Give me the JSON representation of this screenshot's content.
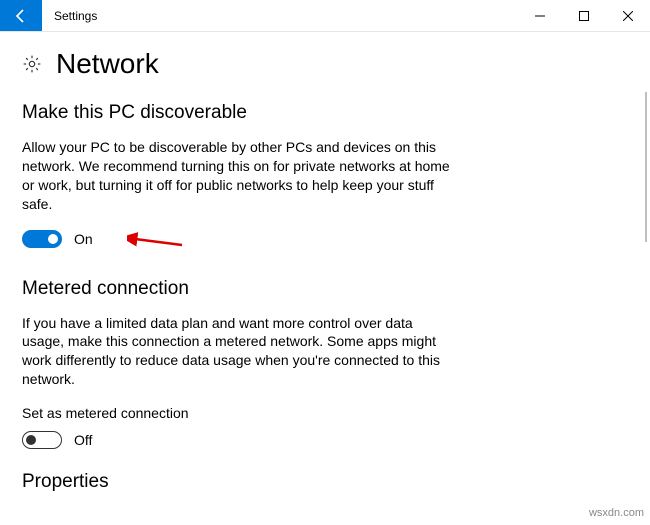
{
  "titlebar": {
    "back_icon": "back-arrow",
    "title": "Settings"
  },
  "page": {
    "heading": "Network"
  },
  "discoverable": {
    "heading": "Make this PC discoverable",
    "description": "Allow your PC to be discoverable by other PCs and devices on this network. We recommend turning this on for private networks at home or work, but turning it off for public networks to help keep your stuff safe.",
    "toggle_state": "On"
  },
  "metered": {
    "heading": "Metered connection",
    "description": "If you have a limited data plan and want more control over data usage, make this connection a metered network. Some apps might work differently to reduce data usage when you're connected to this network.",
    "label": "Set as metered connection",
    "toggle_state": "Off"
  },
  "properties": {
    "heading": "Properties"
  },
  "watermark": "wsxdn.com"
}
